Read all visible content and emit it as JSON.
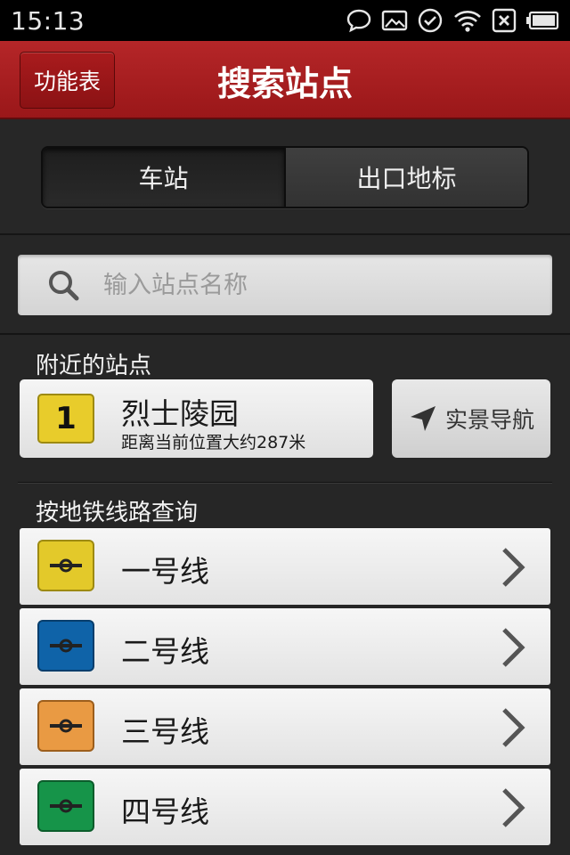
{
  "status_bar": {
    "time": "15:13",
    "icons": [
      "message-icon",
      "image-icon",
      "check-circle-icon",
      "wifi-icon",
      "sim-blocked-icon",
      "battery-icon"
    ]
  },
  "header": {
    "menu_label": "功能表",
    "title": "搜索站点"
  },
  "tabs": [
    {
      "label": "车站",
      "active": true
    },
    {
      "label": "出口地标",
      "active": false
    }
  ],
  "search": {
    "placeholder": "输入站点名称"
  },
  "nearby": {
    "section_label": "附近的站点",
    "line_number": "1",
    "line_color": "#e8cc2b",
    "station_name": "烈士陵园",
    "distance_text": "距离当前位置大约287米",
    "ar_button_label": "实景导航"
  },
  "lines": {
    "section_label": "按地铁线路查询",
    "items": [
      {
        "name": "一号线",
        "color": "#e3c92a",
        "border": "#9d8a12"
      },
      {
        "name": "二号线",
        "color": "#0f63a8",
        "border": "#083e6c"
      },
      {
        "name": "三号线",
        "color": "#e99a43",
        "border": "#9c5e1c"
      },
      {
        "name": "四号线",
        "color": "#169449",
        "border": "#0b5c2b"
      }
    ]
  }
}
